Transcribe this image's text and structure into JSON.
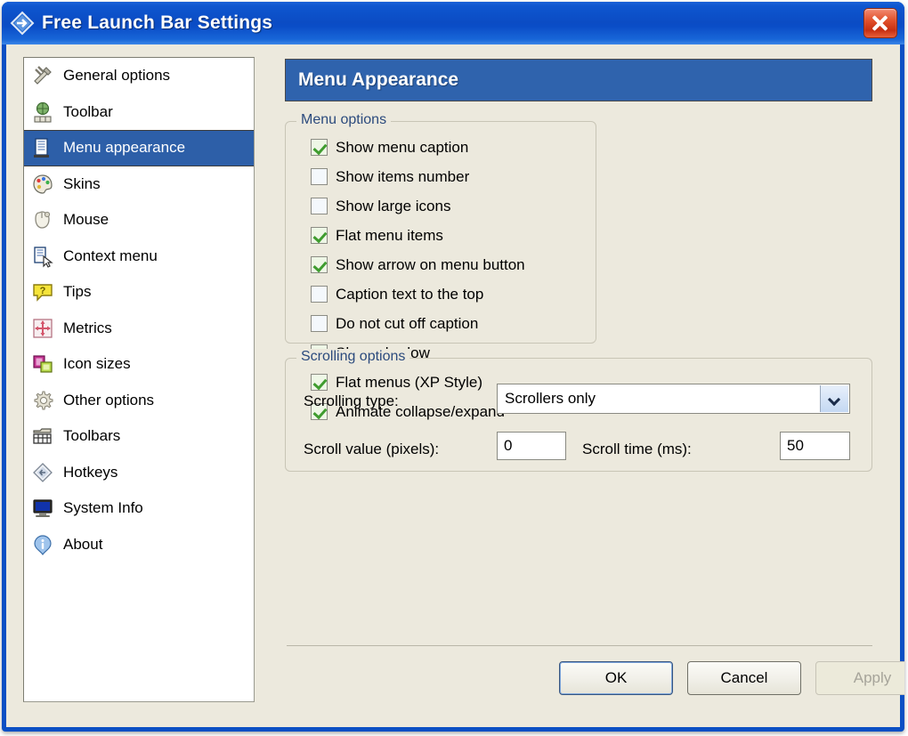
{
  "window": {
    "title": "Free Launch Bar Settings",
    "app_icon": "diamond-arrow-icon",
    "close_label": "Close",
    "titlebar_color": "#0b4cc4",
    "face_color": "#ece9dd"
  },
  "sidebar": {
    "items": [
      {
        "label": "General options",
        "icon": "tools-icon",
        "selected": false
      },
      {
        "label": "Toolbar",
        "icon": "toolbar-icon",
        "selected": false
      },
      {
        "label": "Menu appearance",
        "icon": "menu-icon",
        "selected": true
      },
      {
        "label": "Skins",
        "icon": "palette-icon",
        "selected": false
      },
      {
        "label": "Mouse",
        "icon": "mouse-icon",
        "selected": false
      },
      {
        "label": "Context menu",
        "icon": "context-menu-icon",
        "selected": false
      },
      {
        "label": "Tips",
        "icon": "question-bubble-icon",
        "selected": false
      },
      {
        "label": "Metrics",
        "icon": "metrics-arrows-icon",
        "selected": false
      },
      {
        "label": "Icon sizes",
        "icon": "icon-sizes-icon",
        "selected": false
      },
      {
        "label": "Other options",
        "icon": "gear-icon",
        "selected": false
      },
      {
        "label": "Toolbars",
        "icon": "toolbars-icon",
        "selected": false
      },
      {
        "label": "Hotkeys",
        "icon": "hotkeys-diamond-icon",
        "selected": false
      },
      {
        "label": "System Info",
        "icon": "monitor-icon",
        "selected": false
      },
      {
        "label": "About",
        "icon": "info-icon",
        "selected": false
      }
    ],
    "selected_color": "#2d5fa8"
  },
  "main": {
    "header": "Menu Appearance",
    "menu_options": {
      "title": "Menu options",
      "checkboxes": [
        {
          "label": "Show menu caption",
          "checked": true
        },
        {
          "label": "Show items number",
          "checked": false
        },
        {
          "label": "Show large icons",
          "checked": false
        },
        {
          "label": "Flat menu items",
          "checked": true
        },
        {
          "label": "Show arrow on menu button",
          "checked": true
        },
        {
          "label": "Caption text to the top",
          "checked": false
        },
        {
          "label": "Do not cut off caption",
          "checked": false
        },
        {
          "label": "Show shadow",
          "checked": true
        },
        {
          "label": "Flat menus (XP Style)",
          "checked": true
        },
        {
          "label": "Animate collapse/expand",
          "checked": true
        }
      ]
    },
    "scrolling_options": {
      "title": "Scrolling options",
      "scrolling_type_label": "Scrolling type:",
      "scrolling_type_value": "Scrollers only",
      "scroll_value_label": "Scroll value (pixels):",
      "scroll_value": "0",
      "scroll_time_label": "Scroll time (ms):",
      "scroll_time": "50"
    }
  },
  "buttons": {
    "ok": "OK",
    "cancel": "Cancel",
    "apply": "Apply"
  }
}
